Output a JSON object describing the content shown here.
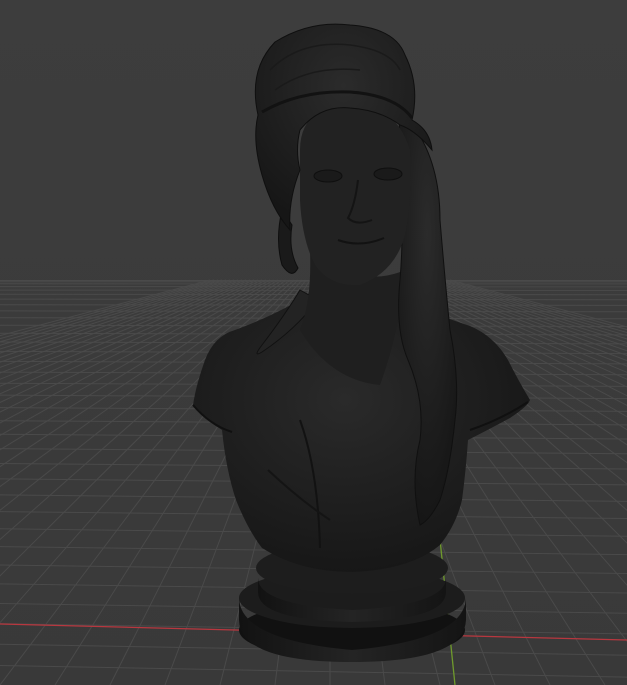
{
  "viewport": {
    "background_color": "#3b3b3b",
    "grid_color": "#4a4a4a",
    "x_axis_color": "#b8373f",
    "y_axis_color": "#6f9a2c",
    "model_color": "#1e1e1e"
  },
  "grid": {
    "visible": true
  },
  "model": {
    "shading": "dark-solid"
  }
}
